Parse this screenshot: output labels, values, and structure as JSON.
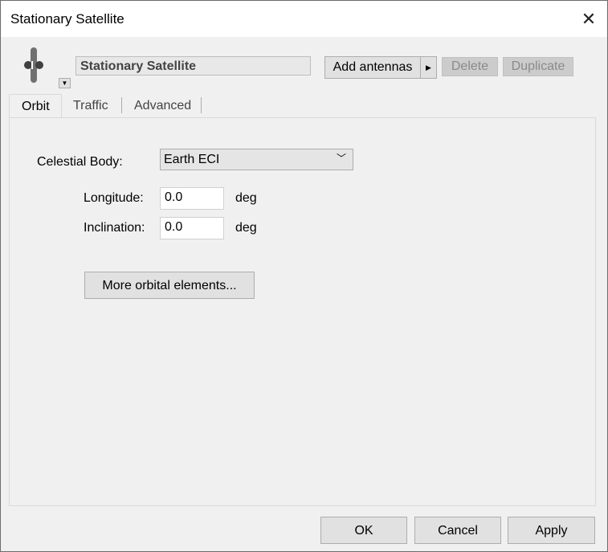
{
  "window": {
    "title": "Stationary Satellite",
    "close": "✕"
  },
  "header": {
    "name": "Stationary Satellite",
    "add_antennas": "Add antennas",
    "delete": "Delete",
    "duplicate": "Duplicate",
    "icon": "satellite-icon"
  },
  "tabs": [
    {
      "label": "Orbit"
    },
    {
      "label": "Traffic"
    },
    {
      "label": "Advanced"
    }
  ],
  "orbit": {
    "celestial_label": "Celestial Body:",
    "celestial_value": "Earth ECI",
    "longitude_label": "Longitude:",
    "longitude_value": "0.0",
    "longitude_unit": "deg",
    "inclination_label": "Inclination:",
    "inclination_value": "0.0",
    "inclination_unit": "deg",
    "more": "More orbital elements..."
  },
  "footer": {
    "ok": "OK",
    "cancel": "Cancel",
    "apply": "Apply"
  }
}
